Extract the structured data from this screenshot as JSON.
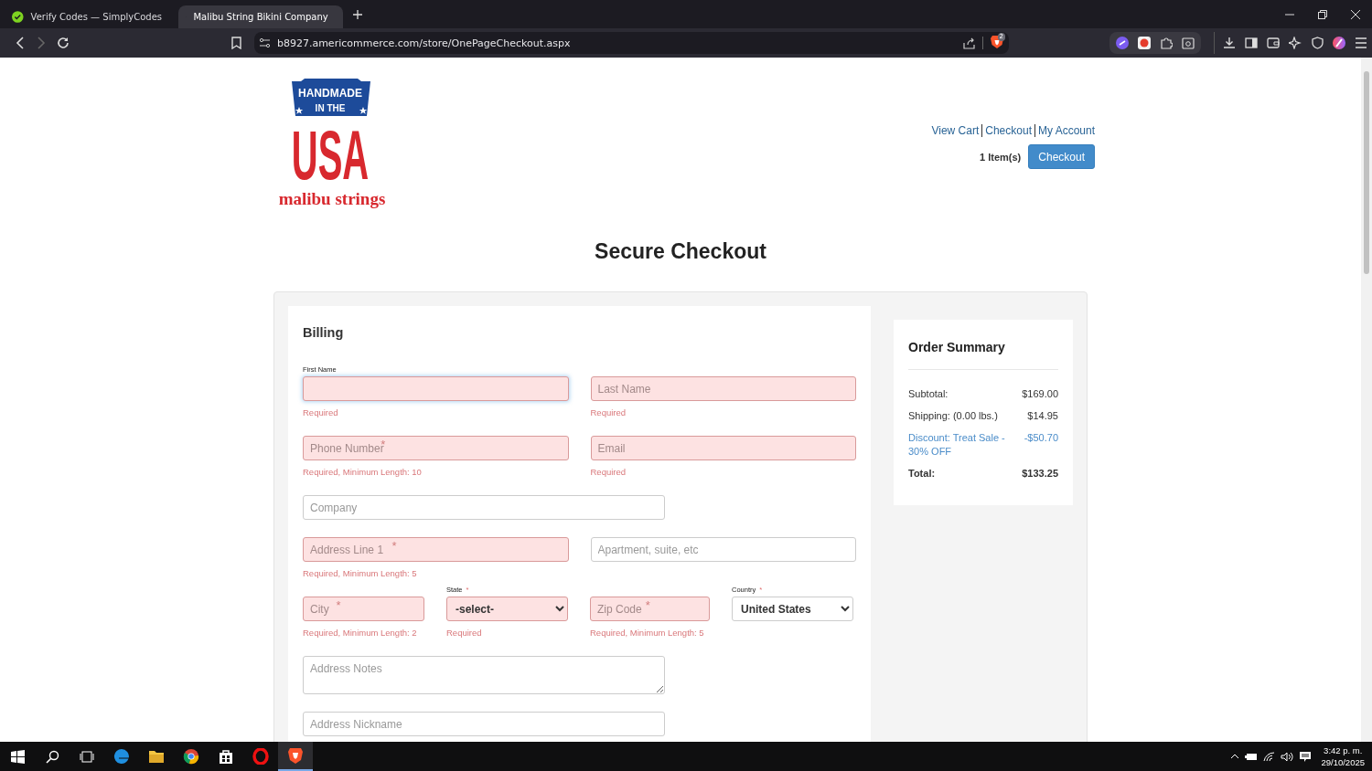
{
  "browser": {
    "tabs": [
      {
        "title": "Verify Codes — SimplyCodes",
        "selected": false
      },
      {
        "title": "Malibu String Bikini Company",
        "selected": true
      }
    ],
    "url": "b8927.americommerce.com/store/OnePageCheckout.aspx",
    "shield_badge": "2"
  },
  "logo": {
    "top": "HANDMADE",
    "middle": "IN THE",
    "main": "USA",
    "bottom": "malibu strings"
  },
  "header": {
    "links": [
      "View Cart",
      "Checkout",
      "My Account"
    ],
    "cart_count": "1 Item(s)",
    "checkout_button": "Checkout"
  },
  "title": "Secure Checkout",
  "billing": {
    "title": "Billing",
    "rows": [
      [
        {
          "kind": "input",
          "label": "First Name",
          "focused": true,
          "invalid": true,
          "error": "Required"
        },
        {
          "kind": "input",
          "placeholder": "Last Name",
          "invalid": true,
          "error": "Required"
        }
      ],
      [
        {
          "kind": "input",
          "placeholder": "Phone Number",
          "mark": "*",
          "invalid": true,
          "error": "Required, Minimum Length: 10"
        },
        {
          "kind": "input",
          "placeholder": "Email",
          "invalid": true,
          "error": "Required"
        }
      ],
      [
        {
          "kind": "input",
          "placeholder": "Company",
          "invalid": false
        }
      ],
      [
        {
          "kind": "input",
          "placeholder": "Address Line 1",
          "mark": "*",
          "invalid": true,
          "error": "Required, Minimum Length: 5"
        },
        {
          "kind": "input",
          "placeholder": "Apartment, suite, etc",
          "invalid": false
        }
      ],
      [
        {
          "kind": "input",
          "placeholder": "City",
          "mark": "*",
          "invalid": true,
          "error": "Required, Minimum Length: 2"
        },
        {
          "kind": "select",
          "label": "State",
          "mark": "*",
          "value": "-select-",
          "invalid": true,
          "error": "Required"
        },
        {
          "kind": "input",
          "placeholder": "Zip Code",
          "mark": "*",
          "invalid": true,
          "error": "Required, Minimum Length: 5"
        },
        {
          "kind": "select",
          "label": "Country",
          "mark": "*",
          "value": "United States",
          "invalid": false
        }
      ],
      [
        {
          "kind": "textarea",
          "placeholder": "Address Notes",
          "invalid": false
        }
      ],
      [
        {
          "kind": "input",
          "placeholder": "Address Nickname",
          "invalid": false
        }
      ]
    ]
  },
  "order_summary": {
    "title": "Order Summary",
    "rows": [
      {
        "kind": "item",
        "label": "Subtotal:",
        "value": "$169.00"
      },
      {
        "kind": "item",
        "label": "Shipping: (0.00 lbs.)",
        "value": "$14.95"
      },
      {
        "kind": "discount",
        "label": "Discount: Treat Sale - 30% OFF",
        "value": "-$50.70"
      },
      {
        "kind": "total",
        "label": "Total:",
        "value": "$133.25"
      }
    ]
  },
  "taskbar": {
    "apps": [
      {
        "selected": false
      },
      {
        "selected": false
      },
      {
        "selected": false
      },
      {
        "selected": false
      },
      {
        "selected": false
      },
      {
        "selected": true
      }
    ],
    "time": "3:42 p. m.",
    "date": "29/10/2025"
  }
}
